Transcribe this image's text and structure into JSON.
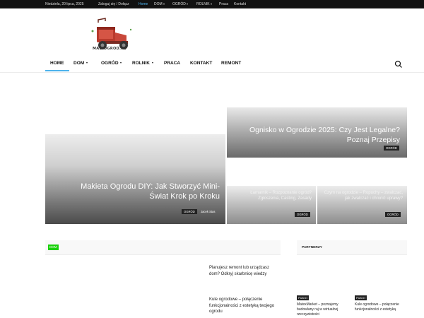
{
  "topbar": {
    "date": "Niedziela, 20 lipca, 2025",
    "login": "Zaloguj się / Dołącz",
    "links": [
      "Home",
      "DOM",
      "OGRÓD",
      "ROLNIK",
      "Praca",
      "Kontakt"
    ]
  },
  "logo": {
    "text": "MALYOGROD.PL"
  },
  "nav": {
    "items": [
      "HOME",
      "DOM",
      "OGRÓD",
      "ROLNIK",
      "PRACA",
      "KONTAKT",
      "REMONT"
    ]
  },
  "hero": {
    "big": {
      "title": "Makieta Ogrodu DIY: Jak Stworzyć Mini-Świat Krok po Kroku",
      "category": "OGRÓD",
      "author": "Jacek Stas"
    },
    "top": {
      "title": "Ognisko w Ogrodzie 2025: Czy Jest Legalne? Poznaj Przepisy",
      "category": "OGRÓD"
    },
    "small1": {
      "title": "Łamarnik – Rozpoznanie ogród? Zgłoszenia, Casting, Zasady",
      "category": "OGRÓD"
    },
    "small2": {
      "title": "Czym na ogrodzie – Ropuchy – zwalczać, jak zwalczać i chronić uprawy?",
      "category": "OGRÓD"
    }
  },
  "section": {
    "badge": "DOM",
    "articles": [
      "Planujesz remont lub urządzasz dom? Odkryj skarbnicę wiedzy",
      "Kule ogrodowe – połączenie funkcjonalności z estetyką twojego ogrodu"
    ]
  },
  "sidebar": {
    "heading": "PARTNERZY",
    "posts": [
      {
        "badge": "Partner",
        "title": "MatexMarket – poznajemy budowlany raj w wirtualnej rzeczywistości"
      },
      {
        "badge": "Partner",
        "title": "Kule ogrodowe – połączenie funkcjonalności z estetyką"
      }
    ]
  },
  "colors": {
    "accent": "#4db2ec",
    "dom_badge": "#1ad10b",
    "topbar_bg": "#111111"
  }
}
